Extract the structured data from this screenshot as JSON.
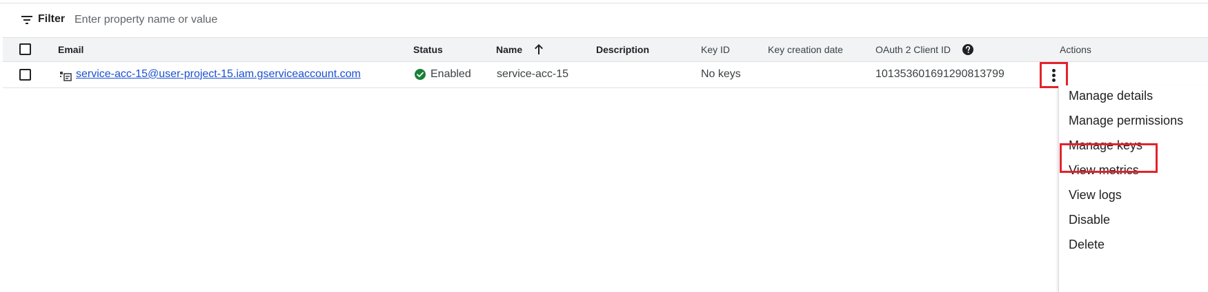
{
  "filter": {
    "label": "Filter",
    "placeholder": "Enter property name or value",
    "value": ""
  },
  "table": {
    "columns": {
      "email": "Email",
      "status": "Status",
      "name": "Name",
      "description": "Description",
      "key_id": "Key ID",
      "key_creation_date": "Key creation date",
      "oauth_client_id": "OAuth 2 Client ID",
      "actions": "Actions"
    },
    "sort": {
      "column": "name",
      "direction": "ascending"
    },
    "rows": [
      {
        "email": "service-acc-15@user-project-15.iam.gserviceaccount.com",
        "status": "Enabled",
        "name": "service-acc-15",
        "description": "",
        "key_id": "No keys",
        "key_creation_date": "",
        "oauth_client_id": "101353601691290813799"
      }
    ]
  },
  "actions_menu": {
    "items": [
      "Manage details",
      "Manage permissions",
      "Manage keys",
      "View metrics",
      "View logs",
      "Disable",
      "Delete"
    ],
    "highlighted": "Manage keys"
  },
  "colors": {
    "link": "#1a4fd0",
    "status_enabled": "#188038",
    "highlight_border": "#e3222b",
    "header_background": "#f1f3f4"
  },
  "icons": {
    "filter": "filter-icon",
    "sort": "arrow-up-icon",
    "help": "help-icon",
    "service_account": "service-account-icon",
    "status": "check-circle-icon",
    "actions": "more-vert-icon"
  }
}
